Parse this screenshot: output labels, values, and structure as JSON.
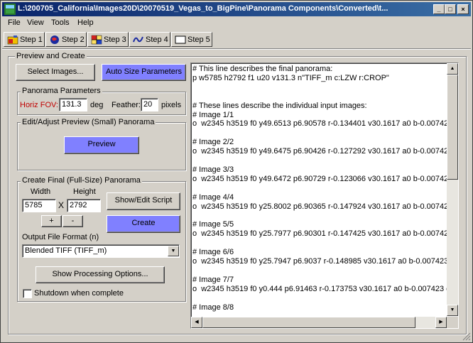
{
  "window": {
    "title": "L:\\200705_California\\Images20D\\20070519_Vegas_to_BigPine\\Panorama Components\\Converted\\t...",
    "minimize": "_",
    "maximize": "□",
    "close": "×"
  },
  "menu": [
    "File",
    "View",
    "Tools",
    "Help"
  ],
  "tabs": [
    "Step 1",
    "Step 2",
    "Step 3",
    "Step 4",
    "Step 5"
  ],
  "preview_create": {
    "group_label": "Preview and Create",
    "select_images": "Select Images...",
    "auto_size": "Auto Size Parameters"
  },
  "pano_params": {
    "group_label": "Panorama Parameters",
    "hfov_label": "Horiz FOV:",
    "hfov_value": "131.3",
    "deg_label": "deg",
    "feather_label": "Feather:",
    "feather_value": "20",
    "pixels_label": "pixels"
  },
  "preview_group": {
    "group_label": "Edit/Adjust Preview (Small) Panorama",
    "preview_button": "Preview"
  },
  "final_group": {
    "group_label": "Create Final (Full-Size) Panorama",
    "width_label": "Width",
    "height_label": "Height",
    "width_value": "5785",
    "height_value": "2792",
    "x_label": "X",
    "plus": "+",
    "minus": "-",
    "show_edit_script": "Show/Edit Script",
    "create": "Create",
    "format_label": "Output File Format (n)",
    "format_value": "Blended TIFF (TIFF_m)",
    "processing_options": "Show Processing Options...",
    "shutdown_label": "Shutdown when complete"
  },
  "script_lines": [
    "# This line describes the final panorama:",
    "p w5785 h2792 f1 u20 v131.3 n\"TIFF_m c:LZW r:CROP\"",
    "",
    "",
    "# These lines describe the individual input images:",
    "# Image 1/1",
    "o  w2345 h3519 f0 y49.6513 p6.90578 r-0.134401 v30.1617 a0 b-0.007423",
    "",
    "# Image 2/2",
    "o  w2345 h3519 f0 y49.6475 p6.90426 r-0.127292 v30.1617 a0 b-0.007423",
    "",
    "# Image 3/3",
    "o  w2345 h3519 f0 y49.6472 p6.90729 r-0.123066 v30.1617 a0 b-0.007423",
    "",
    "# Image 4/4",
    "o  w2345 h3519 f0 y25.8002 p6.90365 r-0.147924 v30.1617 a0 b-0.007423",
    "",
    "# Image 5/5",
    "o  w2345 h3519 f0 y25.7977 p6.90301 r-0.147425 v30.1617 a0 b-0.007423",
    "",
    "# Image 6/6",
    "o  w2345 h3519 f0 y25.7947 p6.9037 r-0.148985 v30.1617 a0 b-0.007423 c",
    "",
    "# Image 7/7",
    "o  w2345 h3519 f0 y0.444 p6.91463 r-0.173753 v30.1617 a0 b-0.007423 c(",
    "",
    "# Image 8/8"
  ],
  "colors": {
    "button_blue": "#8080ff",
    "hfov_red": "#c00000",
    "titlebar": "#0a246a"
  }
}
